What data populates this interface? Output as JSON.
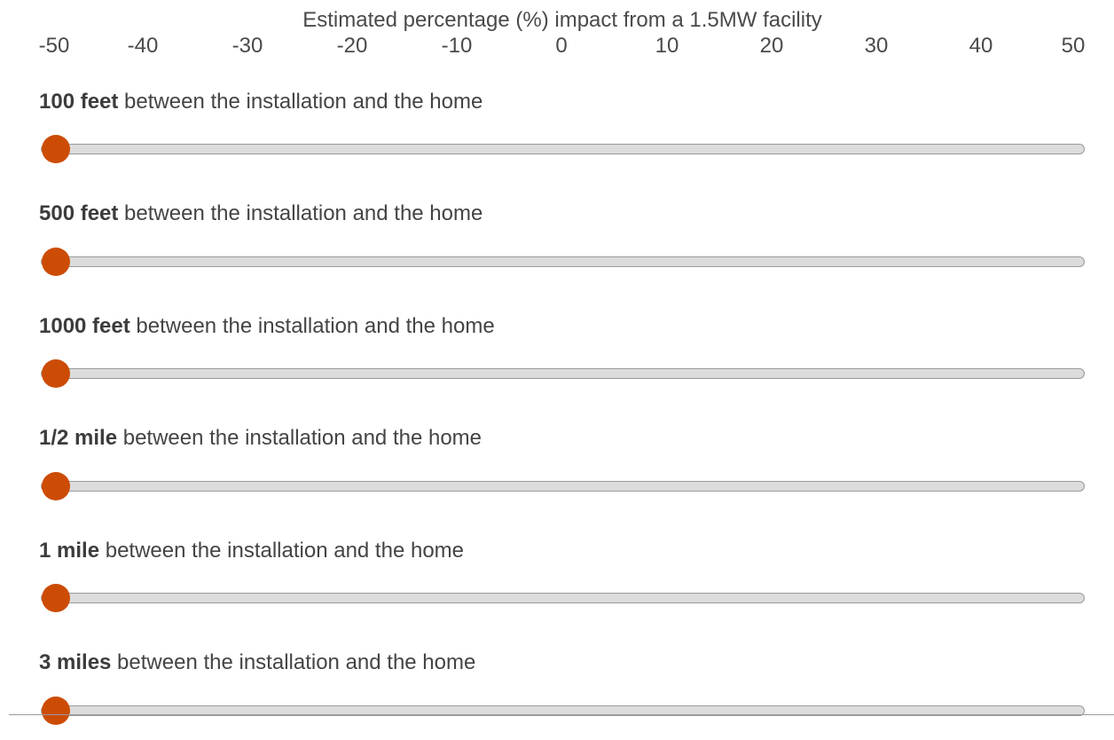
{
  "scale": {
    "title": "Estimated percentage (%) impact from a 1.5MW facility",
    "min": -50,
    "max": 50,
    "ticks": [
      "-50",
      "-40",
      "-30",
      "-20",
      "-10",
      "0",
      "10",
      "20",
      "30",
      "40",
      "50"
    ]
  },
  "colors": {
    "handle": "#cc4c05",
    "track": "#dcdcdc",
    "track_border": "#9a9a9a"
  },
  "rows": [
    {
      "distance": "100 feet",
      "suffix": " between the installation and the home",
      "value": -50
    },
    {
      "distance": "500 feet",
      "suffix": " between the installation and the home",
      "value": -50
    },
    {
      "distance": "1000 feet",
      "suffix": " between the installation and the home",
      "value": -50
    },
    {
      "distance": "1/2 mile",
      "suffix": " between the installation and the home",
      "value": -50
    },
    {
      "distance": "1 mile",
      "suffix": " between the installation and the home",
      "value": -50
    },
    {
      "distance": "3 miles",
      "suffix": " between the installation and the home",
      "value": -50
    }
  ]
}
